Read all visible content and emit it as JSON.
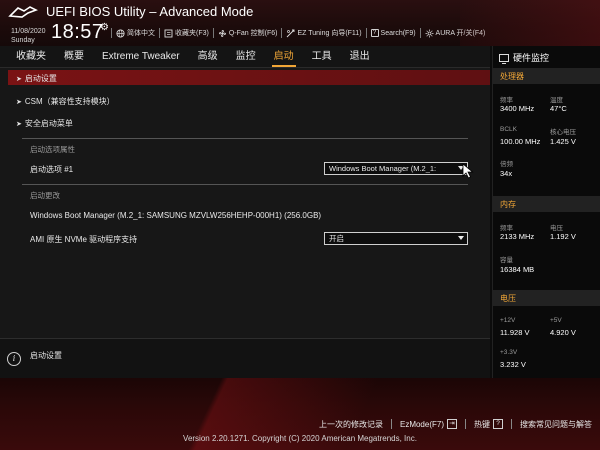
{
  "header": {
    "title": "UEFI BIOS Utility – Advanced Mode",
    "date": "11/08/2020",
    "day": "Sunday",
    "time": "18:57",
    "toolbar": [
      {
        "icon": "globe-icon",
        "label": "简体中文"
      },
      {
        "icon": "bookmark-icon",
        "label": "收藏夹(F3)"
      },
      {
        "icon": "fan-icon",
        "label": "Q-Fan 控制(F6)"
      },
      {
        "icon": "ez-tuning-icon",
        "label": "EZ Tuning 向导(F11)"
      },
      {
        "icon": "search-icon",
        "label": "Search(F9)"
      },
      {
        "icon": "aura-icon",
        "label": "AURA 开/关(F4)"
      }
    ]
  },
  "menu": {
    "items": [
      "收藏夹",
      "概要",
      "Extreme Tweaker",
      "高级",
      "监控",
      "启动",
      "工具",
      "退出"
    ],
    "active_index": 5
  },
  "main": {
    "rows": [
      {
        "label": "启动设置"
      },
      {
        "label": "CSM（兼容性支持模块）"
      },
      {
        "label": "安全启动菜单"
      }
    ],
    "boot_option_priorities_label": "启动选项属性",
    "boot_option_1_label": "启动选项 #1",
    "boot_option_1_value": "Windows Boot Manager (M.2_1:",
    "boot_override_label": "启动更改",
    "boot_override_item": "Windows Boot Manager (M.2_1: SAMSUNG MZVLW256HEHP-000H1) (256.0GB)",
    "ami_nvme_label": "AMI 原生 NVMe 驱动程序支持",
    "ami_nvme_value": "开启"
  },
  "help": {
    "text": "启动设置"
  },
  "hw_monitor": {
    "title": "硬件监控",
    "cpu": {
      "section": "处理器",
      "freq_label": "频率",
      "freq_value": "3400 MHz",
      "temp_label": "温度",
      "temp_value": "47°C",
      "bclk_label": "BCLK",
      "bclk_value": "100.00 MHz",
      "core_voltage_label": "核心电压",
      "core_voltage_value": "1.425 V",
      "ratio_label": "倍频",
      "ratio_value": "34x"
    },
    "memory": {
      "section": "内存",
      "freq_label": "频率",
      "freq_value": "2133 MHz",
      "volt_label": "电压",
      "volt_value": "1.192 V",
      "capacity_label": "容量",
      "capacity_value": "16384 MB"
    },
    "voltage": {
      "section": "电压",
      "v12_label": "+12V",
      "v12_value": "11.928 V",
      "v5_label": "+5V",
      "v5_value": "4.920 V",
      "v33_label": "+3.3V",
      "v33_value": "3.232 V"
    }
  },
  "footer": {
    "last_modified": "上一次的修改记录",
    "ezmode": "EzMode(F7)",
    "ezmode_key": "⇥",
    "hotkeys": "热键",
    "hotkeys_key": "?",
    "faq": "搜索常见问题与解答",
    "copyright": "Version 2.20.1271. Copyright (C) 2020 American Megatrends, Inc."
  },
  "colors": {
    "accent": "#f0a637",
    "selected_row": "#7a1314",
    "header_bg": "#1c0b0b"
  }
}
